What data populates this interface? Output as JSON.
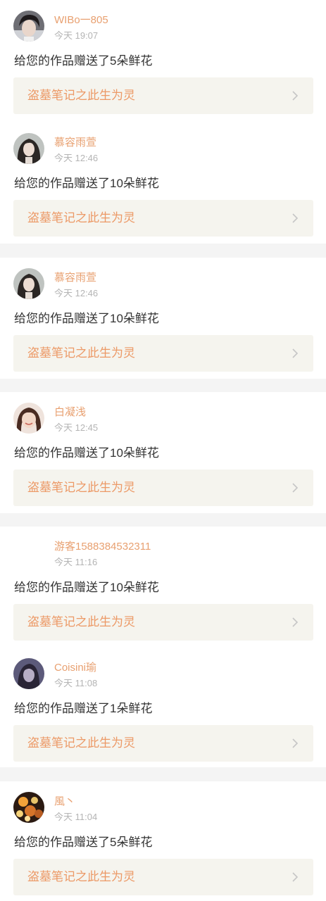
{
  "feed": {
    "items": [
      {
        "username": "WIBo一805",
        "time": "今天 19:07",
        "message": "给您的作品赠送了5朵鲜花",
        "work_title": "盗墓笔记之此生为灵",
        "avatar": "dark-haired-person-photo"
      },
      {
        "username": "慕容雨萱",
        "time": "今天 12:46",
        "message": "给您的作品赠送了10朵鲜花",
        "work_title": "盗墓笔记之此生为灵",
        "avatar": "long-haired-girl-photo"
      },
      {
        "username": "慕容雨萱",
        "time": "今天 12:46",
        "message": "给您的作品赠送了10朵鲜花",
        "work_title": "盗墓笔记之此生为灵",
        "avatar": "long-haired-girl-photo"
      },
      {
        "username": "白凝浅",
        "time": "今天 12:45",
        "message": "给您的作品赠送了10朵鲜花",
        "work_title": "盗墓笔记之此生为灵",
        "avatar": "smiling-woman-photo"
      },
      {
        "username": "游客1588384532311",
        "time": "今天 11:16",
        "message": "给您的作品赠送了10朵鲜花",
        "work_title": "盗墓笔记之此生为灵",
        "avatar": "blank"
      },
      {
        "username": "Coisini瑜",
        "time": "今天 11:08",
        "message": "给您的作品赠送了1朵鲜花",
        "work_title": "盗墓笔记之此生为灵",
        "avatar": "purple-toned-girl-photo"
      },
      {
        "username": "風丶",
        "time": "今天 11:04",
        "message": "给您的作品赠送了5朵鲜花",
        "work_title": "盗墓笔记之此生为灵",
        "avatar": "night-lights-photo"
      }
    ]
  },
  "colors": {
    "username": "#e8a070",
    "work_title": "#ec9966",
    "time": "#b4b4b4",
    "message": "#333333",
    "link_background": "#f5f4ee",
    "separator": "#f4f4f4"
  },
  "icons": {
    "row_arrow": "chevron-right-icon"
  }
}
